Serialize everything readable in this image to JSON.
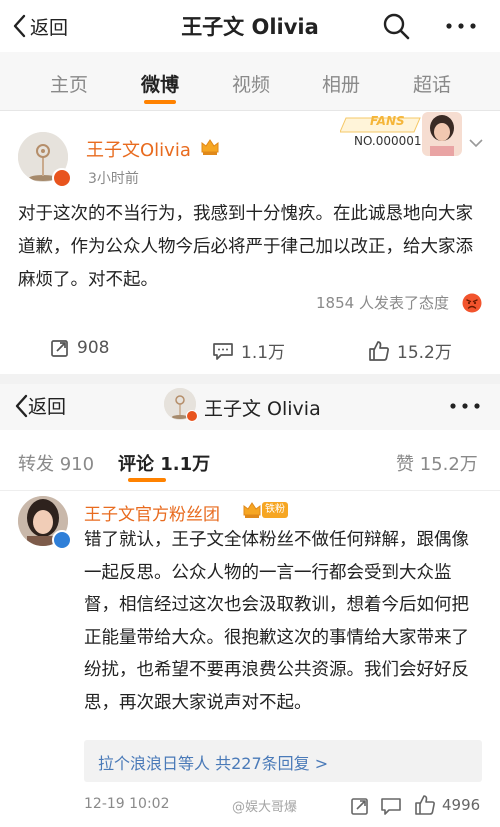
{
  "header": {
    "back_label": "返回",
    "title": "王子文 Olivia"
  },
  "profile_tabs": [
    {
      "label": "主页",
      "active": false
    },
    {
      "label": "微博",
      "active": true
    },
    {
      "label": "视频",
      "active": false
    },
    {
      "label": "相册",
      "active": false
    },
    {
      "label": "超话",
      "active": false
    }
  ],
  "post": {
    "author": "王子文Olivia",
    "time": "3小时前",
    "fans_badge": {
      "title": "FANS",
      "number": "NO.000001"
    },
    "body": "对于这次的不当行为，我感到十分愧疚。在此诚恳地向大家道歉，作为公众人物今后必将严于律己加以改正，给大家添麻烦了。对不起。",
    "reactions": "1854 人发表了态度",
    "repost_count": "908",
    "comment_count": "1.1万",
    "like_count": "15.2万"
  },
  "detail_header": {
    "back_label": "返回",
    "name": "王子文 Olivia"
  },
  "detail_tabs": {
    "repost": "转发 910",
    "comment": "评论 1.1万",
    "like": "赞 15.2万"
  },
  "comment": {
    "author": "王子文官方粉丝团",
    "badge": "铁粉",
    "body": "错了就认，王子文全体粉丝不做任何辩解，跟偶像一起反思。公众人物的一言一行都会受到大众监督，相信经过这次也会汲取教训，想着今后如何把正能量带给大众。很抱歉这次的事情给大家带来了纷扰，也希望不要再浪费公共资源。我们会好好反思，再次跟大家说声对不起。",
    "replies": "拉个浪浪日等人 共227条回复 >",
    "date": "12-19 10:02",
    "watermark": "@娱大哥爆",
    "like_count": "4996"
  },
  "colors": {
    "accent": "#ff8200",
    "author": "#e86b1f",
    "link": "#4a7ab8"
  }
}
